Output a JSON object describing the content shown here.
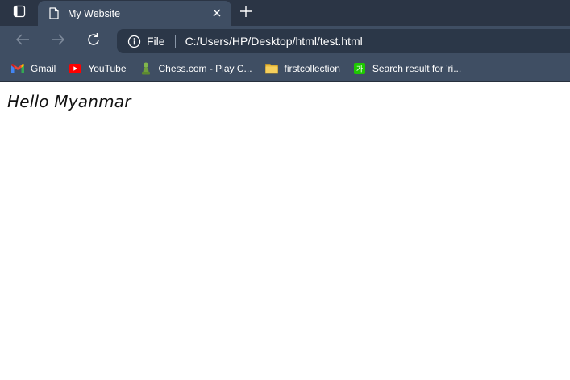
{
  "window": {
    "tab": {
      "title": "My Website"
    }
  },
  "toolbar": {
    "address": {
      "scheme_label": "File",
      "url": "C:/Users/HP/Desktop/html/test.html"
    }
  },
  "bookmarks": [
    {
      "label": "Gmail",
      "icon": "gmail-icon"
    },
    {
      "label": "YouTube",
      "icon": "youtube-icon"
    },
    {
      "label": "Chess.com - Play C...",
      "icon": "chess-pawn-icon"
    },
    {
      "label": "firstcollection",
      "icon": "folder-icon"
    },
    {
      "label": "Search result for 'ri...",
      "icon": "korean-dictionary-icon"
    }
  ],
  "page": {
    "text": "Hello Myanmar"
  },
  "colors": {
    "tabstrip": "#2b3545",
    "toolbar": "#3f4e63",
    "address_bar": "#2b3748",
    "page_background": "#ffffff"
  }
}
